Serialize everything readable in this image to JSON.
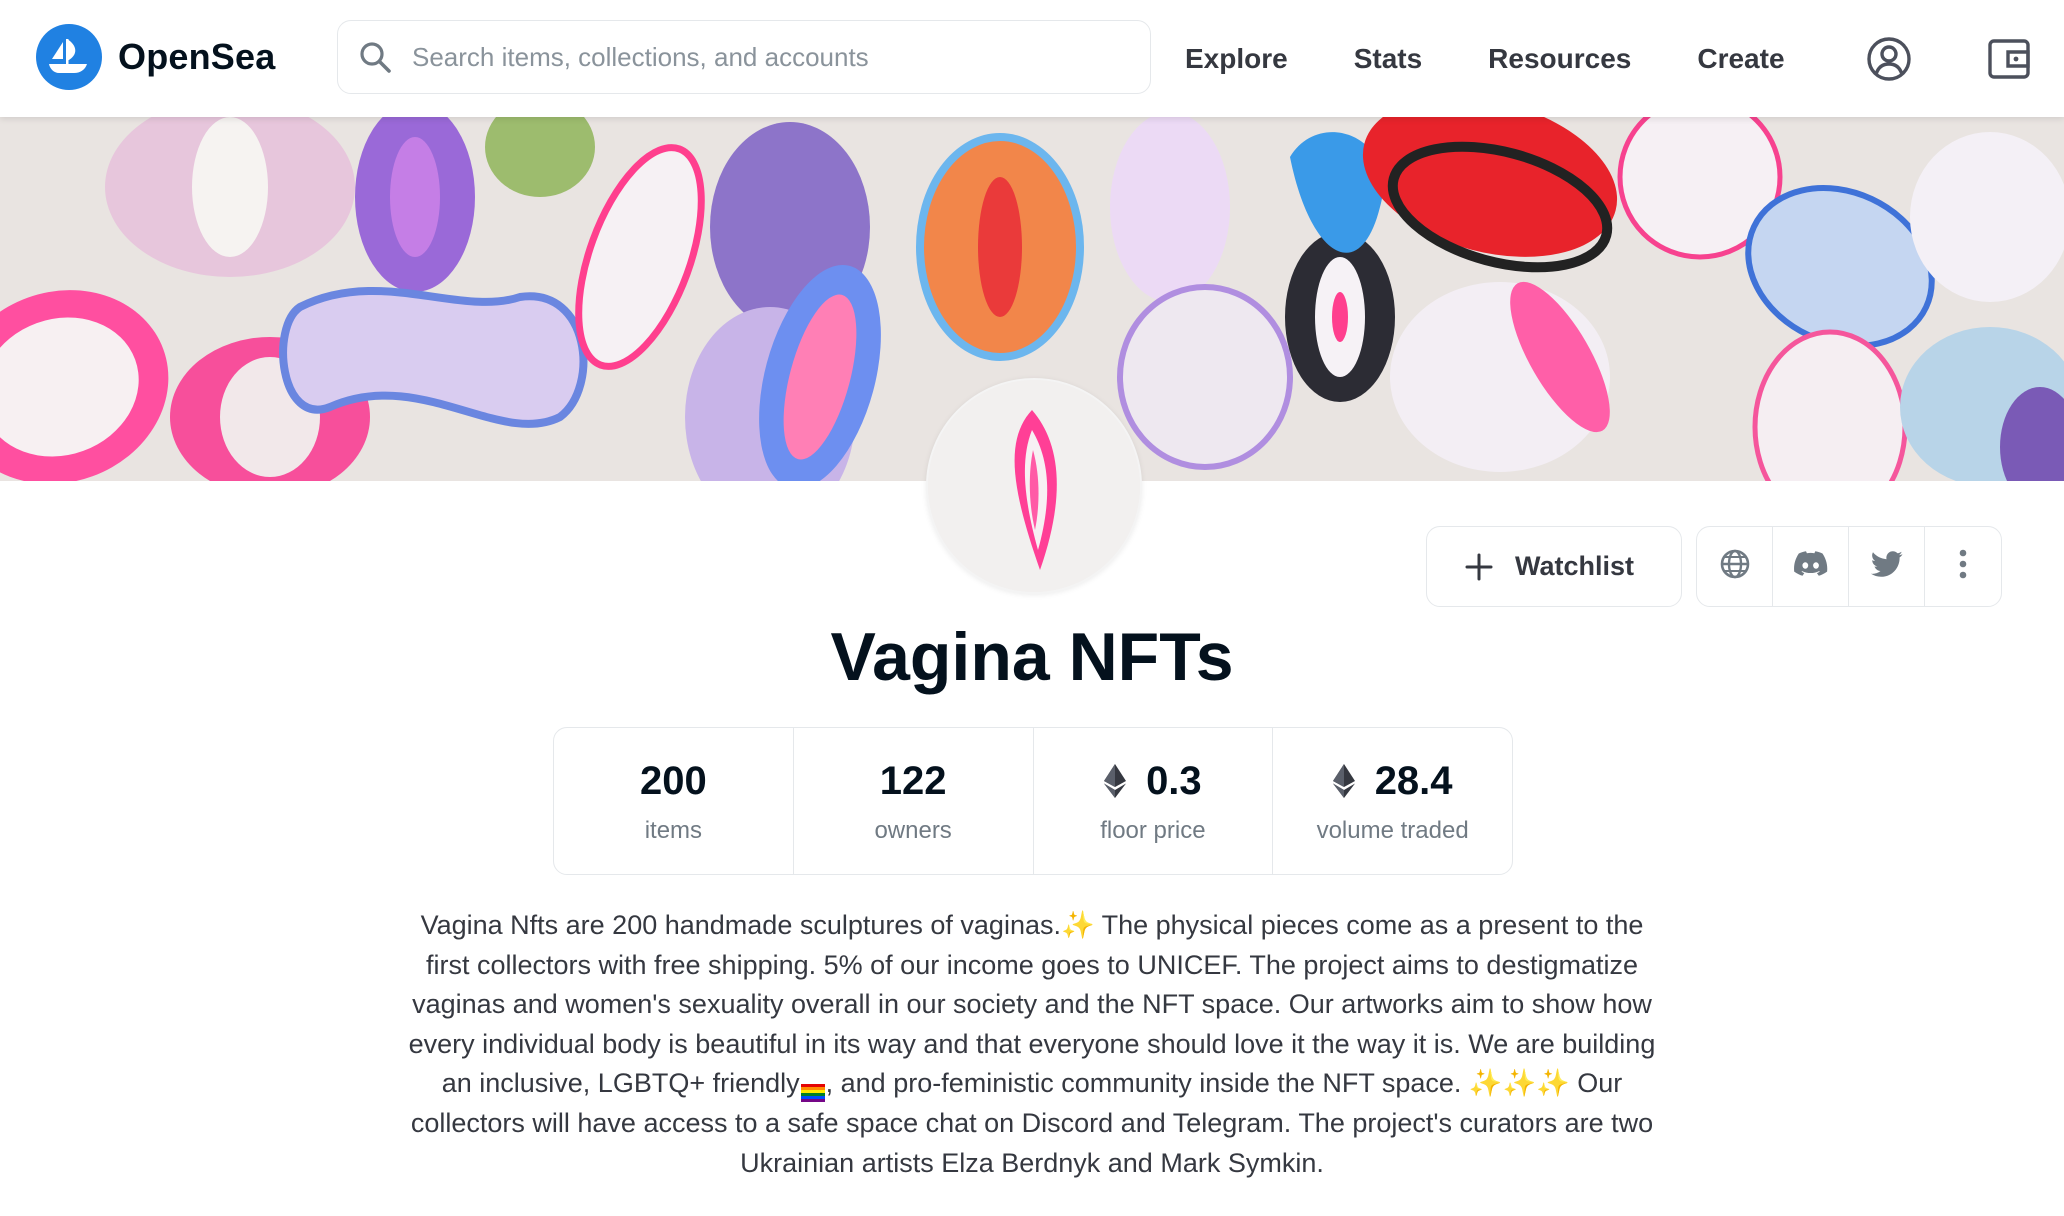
{
  "nav": {
    "brand": "OpenSea",
    "search_placeholder": "Search items, collections, and accounts",
    "links": [
      "Explore",
      "Stats",
      "Resources",
      "Create"
    ]
  },
  "collection": {
    "title": "Vagina NFTs",
    "watchlist_label": "Watchlist",
    "stats": [
      {
        "value": "200",
        "label": "items",
        "eth": false
      },
      {
        "value": "122",
        "label": "owners",
        "eth": false
      },
      {
        "value": "0.3",
        "label": "floor price",
        "eth": true
      },
      {
        "value": "28.4",
        "label": "volume traded",
        "eth": true
      }
    ],
    "description": {
      "part1": "Vagina Nfts are 200 handmade sculptures of vaginas.",
      "sparkle1": "✨",
      "part2": " The physical pieces come as a present to the first collectors with free shipping. 5% of our income goes to UNICEF. The project aims to destigmatize vaginas and women's sexuality overall in our society and the NFT space. Our artworks aim to show how every individual body is beautiful in its way and that everyone should love it the way it is. We are building an inclusive, LGBTQ+ friendly",
      "part3": ", and pro-feministic community inside the NFT space. ",
      "sparkle2": "✨✨✨",
      "part4": " Our collectors will have access to a safe space chat on Discord and Telegram. The project's curators are two Ukrainian artists Elza Berdnyk and Mark Symkin."
    }
  },
  "icons": {
    "logo": "opensea-ship-logo",
    "search": "search-icon",
    "account": "account-icon",
    "wallet": "wallet-icon",
    "plus": "plus-icon",
    "website": "globe-icon",
    "discord": "discord-icon",
    "twitter": "twitter-icon",
    "more": "more-vertical-icon",
    "eth": "ethereum-icon"
  },
  "colors": {
    "brand_blue": "#2081e2",
    "text_dark": "#04111d",
    "text_muted": "#707a83",
    "border": "#e5e8eb"
  }
}
